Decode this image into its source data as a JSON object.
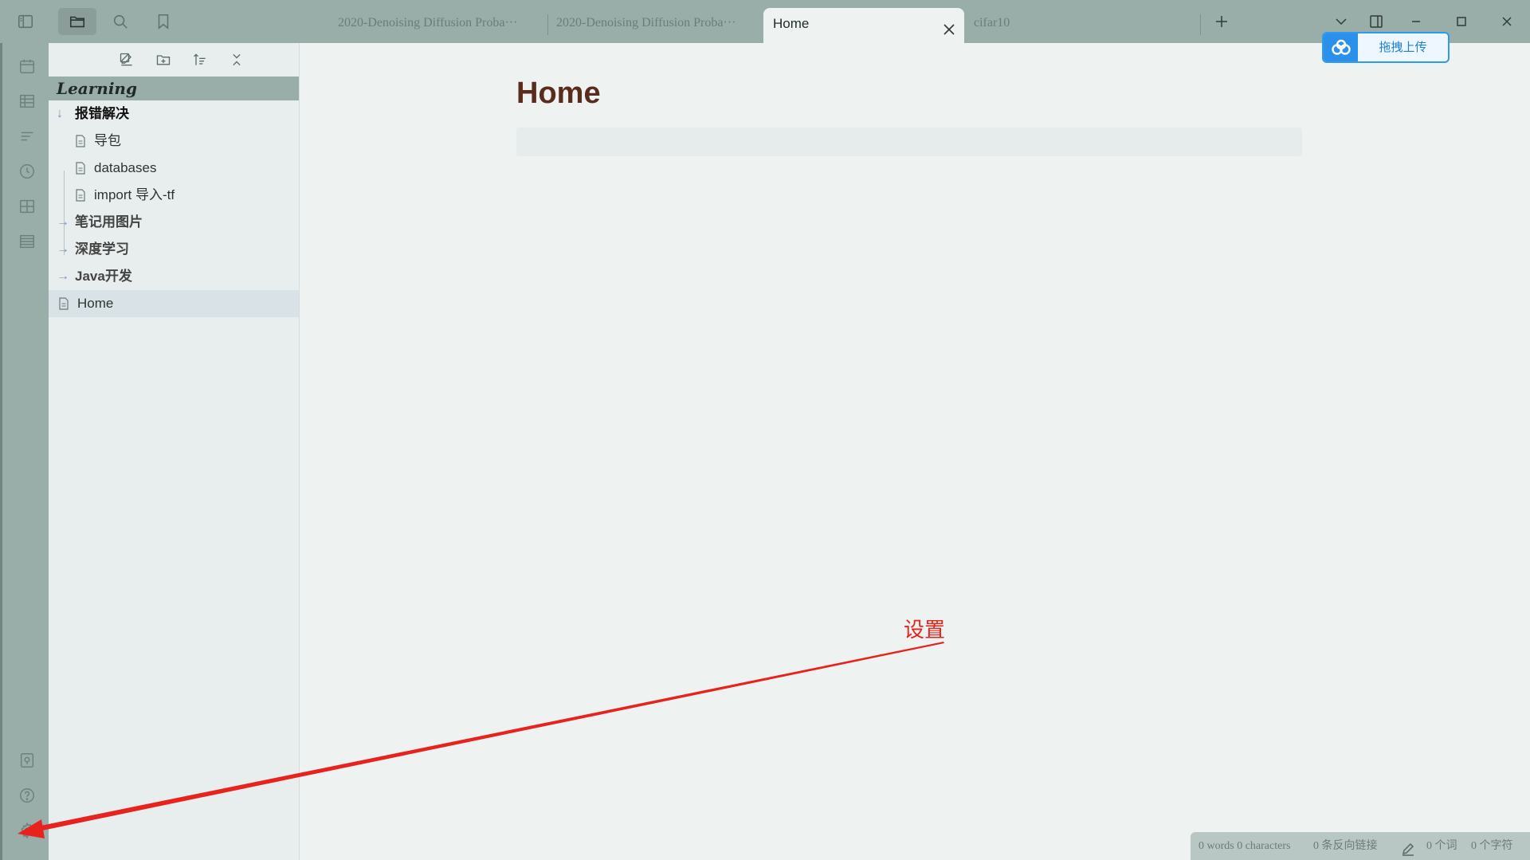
{
  "colors": {
    "accent": "#8090c8",
    "annotation": "#e8231d",
    "title": "#5a2c1e",
    "upload_blue": "#2a90e9"
  },
  "top_icons": [
    "sidebar-toggle-icon",
    "folder-icon",
    "search-icon",
    "bookmark-icon"
  ],
  "ribbon_icons": [
    "calendar-icon",
    "table-icon",
    "outline-icon",
    "clock-icon",
    "grid-icon",
    "list-icon",
    "vault-icon",
    "help-icon",
    "gear-icon"
  ],
  "file_explorer": {
    "vault_name": "Learning",
    "action_icons": [
      "new-note-icon",
      "new-folder-icon",
      "sort-icon",
      "collapse-icon"
    ],
    "items": [
      {
        "type": "folder",
        "label": "报错解决",
        "expanded": true,
        "children": [
          {
            "type": "file",
            "label": "导包"
          },
          {
            "type": "file",
            "label": "databases"
          },
          {
            "type": "file",
            "label": "import 导入-tf"
          }
        ]
      },
      {
        "type": "folder",
        "label": "笔记用图片",
        "expanded": false
      },
      {
        "type": "folder",
        "label": "深度学习",
        "expanded": false
      },
      {
        "type": "folder",
        "label": "Java开发",
        "expanded": false
      },
      {
        "type": "file",
        "label": "Home",
        "selected": true
      }
    ]
  },
  "tabs": [
    {
      "label": "2020-Denoising Diffusion Proba···",
      "active": false
    },
    {
      "label": "2020-Denoising Diffusion Proba···",
      "active": false
    },
    {
      "label": "Home",
      "active": true
    },
    {
      "label": "cifar10",
      "active": false
    }
  ],
  "upload_button": {
    "label": "拖拽上传"
  },
  "editor": {
    "title": "Home"
  },
  "annotation": {
    "text": "设置",
    "target": "settings gear"
  },
  "status_bar": {
    "counts": "0 words 0 characters",
    "backlinks": "0 条反向链接",
    "word_count": "0 个词",
    "char_count": "0 个字符"
  }
}
